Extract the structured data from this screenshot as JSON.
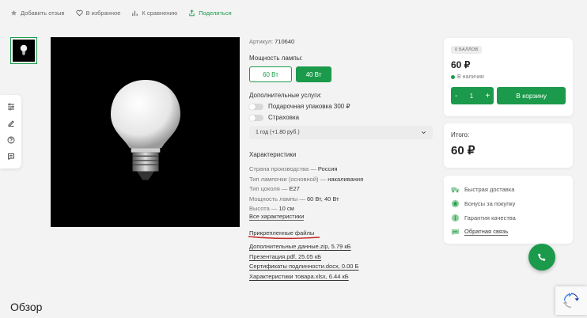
{
  "top_actions": [
    {
      "label": "Добавить отзыв",
      "icon": "star-icon"
    },
    {
      "label": "В избранное",
      "icon": "heart-icon"
    },
    {
      "label": "К сравнению",
      "icon": "bar-chart-icon"
    },
    {
      "label": "Поделиться",
      "icon": "share-icon"
    }
  ],
  "product": {
    "article_label": "Артикул:",
    "article_value": "710640",
    "power_label": "Мощность лампы:",
    "power_options": [
      "60 Вт",
      "40 Вт"
    ],
    "power_selected": "40 Вт",
    "services_label": "Дополнительные услуги:",
    "services": [
      "Подарочная упаковка 300 ₽",
      "Страховка"
    ],
    "warranty_select": "1 год (+1.80 руб.)"
  },
  "characteristics": {
    "title": "Характеристики",
    "items": [
      {
        "name": "Страна производства",
        "sep": " — ",
        "value": "Россия"
      },
      {
        "name": "Тип лампочки (основной)",
        "sep": " — ",
        "value": "накаливания"
      },
      {
        "name": "Тип цоколя",
        "sep": " — ",
        "value": "E27"
      },
      {
        "name": "Мощность лампы",
        "sep": " — ",
        "value": "60 Вт, 40 Вт"
      },
      {
        "name": "Высота",
        "sep": " — ",
        "value": "10 см"
      }
    ],
    "all_link": "Все характеристики"
  },
  "files": {
    "title": "Прикрепленные файлы",
    "items": [
      "Дополнительные данные.zip, 5.79 кБ",
      "Презентация.pdf, 25.05 кБ",
      "Сертификаты подлинности.docx, 0.00 Б",
      "Характеристики товара.xlsx, 6.44 кБ"
    ]
  },
  "buy_card": {
    "badge": "0 БАЛЛОВ",
    "price": "60 ₽",
    "stock": "В наличии",
    "qty_minus": "-",
    "qty": "1",
    "qty_plus": "+",
    "cart_button": "В корзину"
  },
  "total_card": {
    "label": "Итого:",
    "value": "60 ₽"
  },
  "features": [
    {
      "label": "Быстрая доставка",
      "icon": "truck-icon"
    },
    {
      "label": "Бонусы за покупку",
      "icon": "bonus-icon"
    },
    {
      "label": "Гарантия качества",
      "icon": "quality-icon"
    },
    {
      "label": "Обратная связь",
      "icon": "chat-icon"
    }
  ],
  "overview_title": "Обзор",
  "colors": {
    "accent": "#1a9a4a",
    "background": "#f3f3f3",
    "underline_red": "#c62828"
  }
}
